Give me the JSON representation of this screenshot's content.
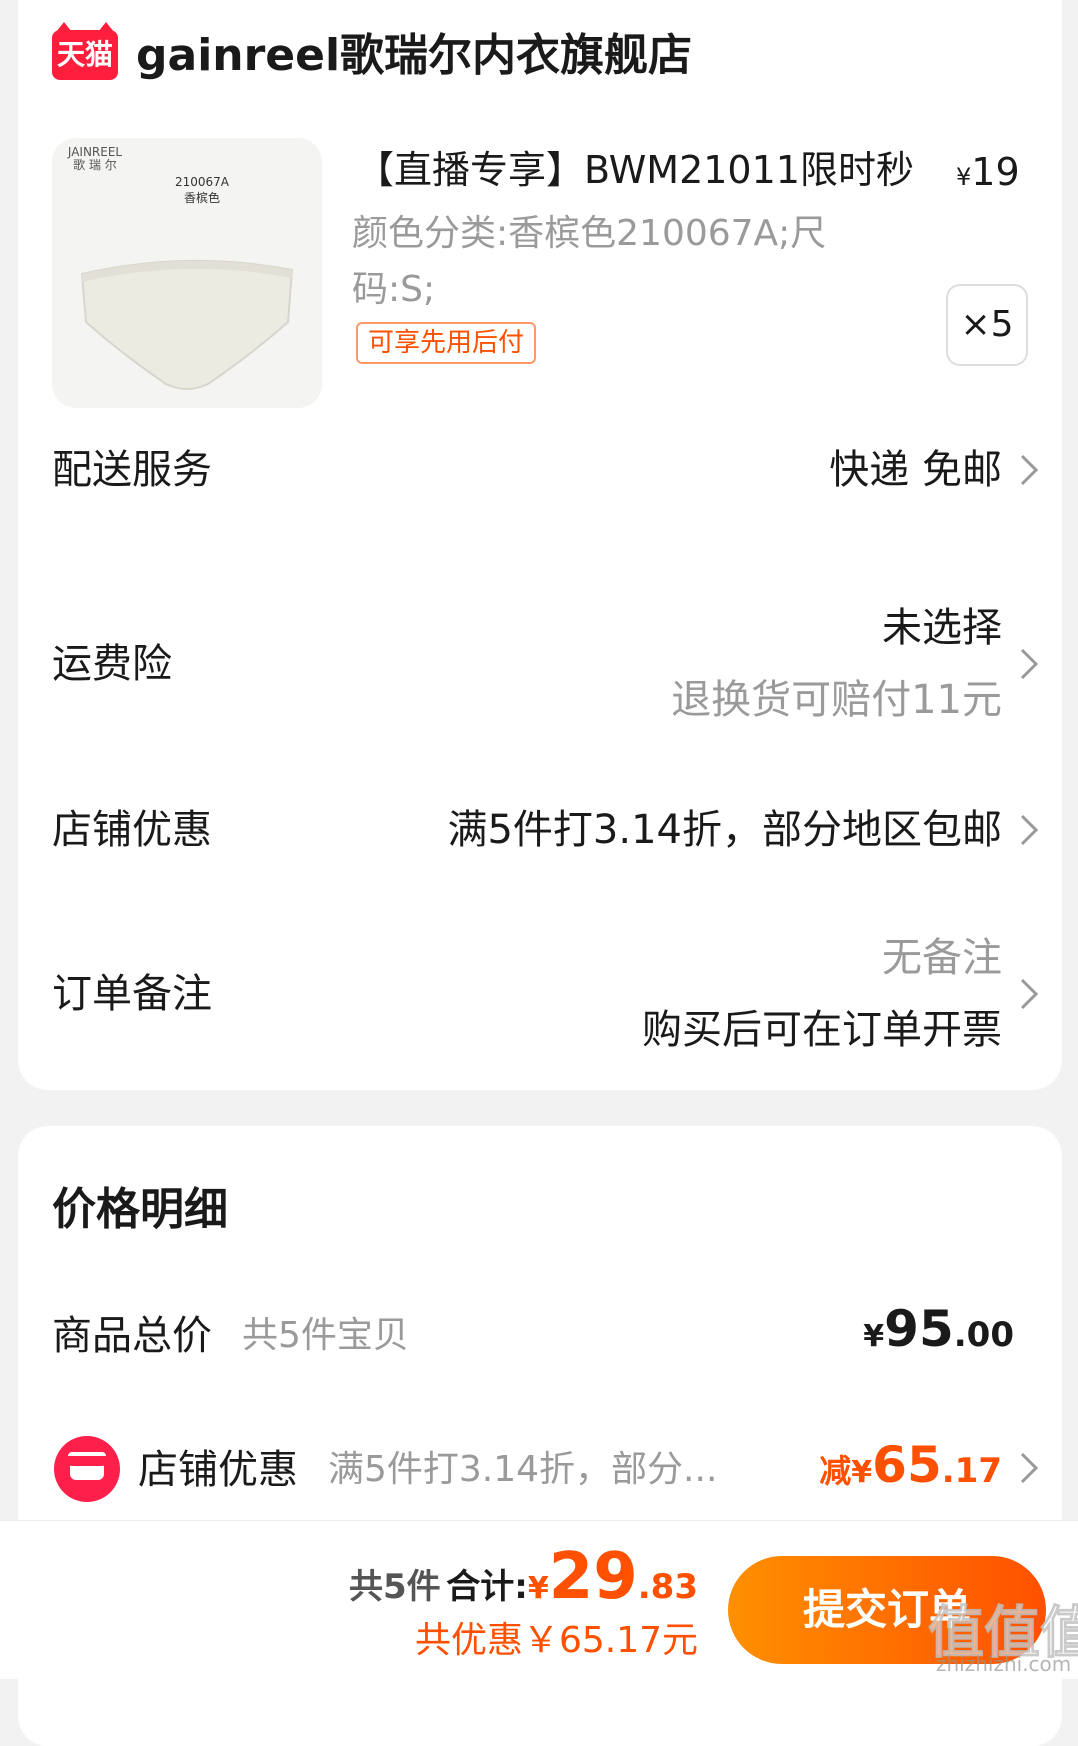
{
  "store": {
    "badge": "天猫",
    "name": "gainreel歌瑞尔内衣旗舰店"
  },
  "product": {
    "image_brand": "JAINREEL",
    "image_brand_cn": "歌 瑞 尔",
    "image_code": "210067A",
    "image_color": "香槟色",
    "title": "【直播专享】BWM21011限时秒",
    "price_symbol": "¥",
    "price": "19",
    "spec": "颜色分类:香槟色210067A;尺码:S;",
    "tag": "可享先用后付",
    "quantity": "×5"
  },
  "rows": {
    "delivery": {
      "label": "配送服务",
      "value": "快递 免邮"
    },
    "insurance": {
      "label": "运费险",
      "value": "未选择",
      "sub": "退换货可赔付11元"
    },
    "store_discount": {
      "label": "店铺优惠",
      "value": "满5件打3.14折，部分地区包邮"
    },
    "note": {
      "label": "订单备注",
      "value": "无备注",
      "sub": "购买后可在订单开票"
    }
  },
  "price_detail": {
    "title": "价格明细",
    "total_label": "商品总价",
    "total_sub": "共5件宝贝",
    "total_currency": "¥",
    "total_int": "95",
    "total_dec": ".00",
    "discount_label": "店铺优惠",
    "discount_sub": "满5件打3.14折，部分...",
    "discount_minus": "减",
    "discount_currency": "¥",
    "discount_int": "65",
    "discount_dec": ".17"
  },
  "bottom": {
    "count": "共5件",
    "sum_label": "合计:",
    "currency": "¥",
    "sum_int": "29",
    "sum_dec": ".83",
    "saved": "共优惠￥65.17元",
    "submit": "提交订单",
    "watermark": "值值值",
    "watermark_url": "zhizhizhi.com"
  },
  "colors": {
    "accent": "#ff5000",
    "brand": "#ff1f3d"
  }
}
